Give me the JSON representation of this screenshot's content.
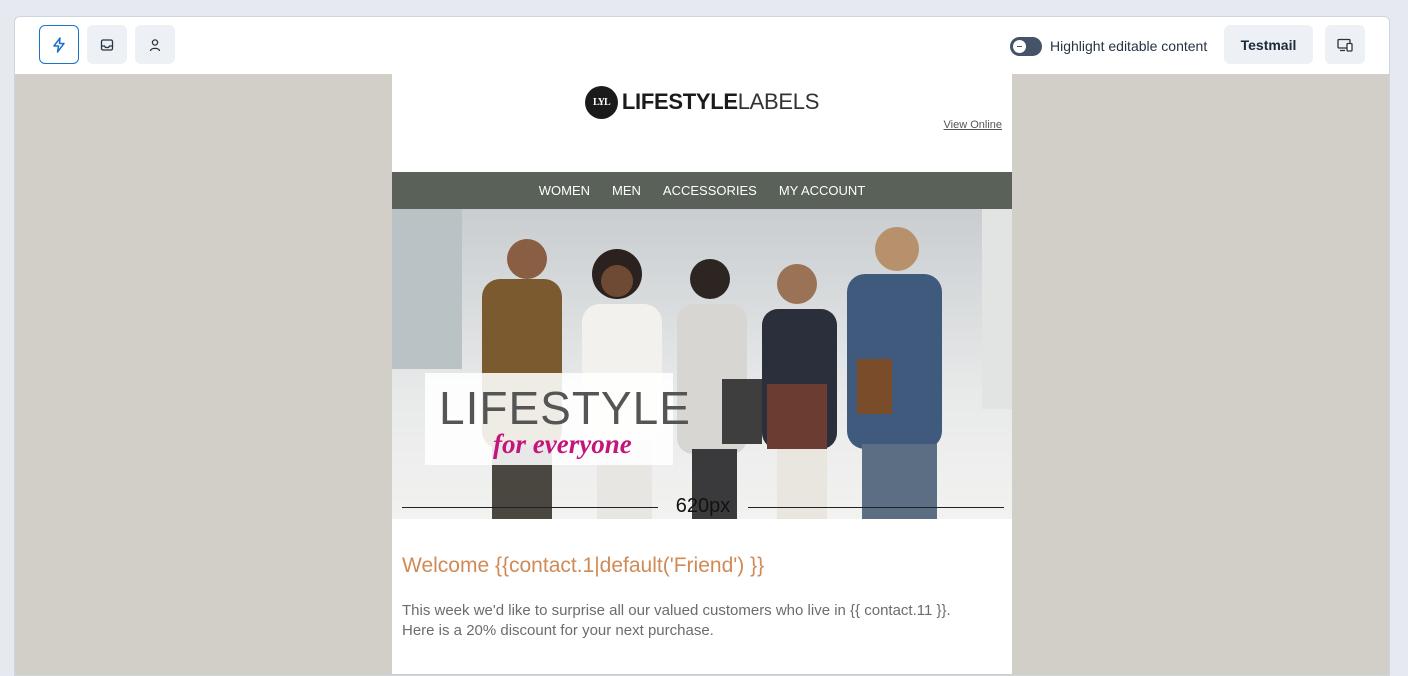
{
  "toolbar": {
    "buttons": [
      {
        "icon": "lightning-icon",
        "active": true
      },
      {
        "icon": "inbox-icon",
        "active": false
      },
      {
        "icon": "user-icon",
        "active": false
      }
    ],
    "highlight_label": "Highlight editable content",
    "highlight_on": true,
    "testmail_label": "Testmail",
    "device_icon": "device-preview-icon"
  },
  "email": {
    "logo_mark": "LYL",
    "logo_bold": "LIFESTYLE",
    "logo_light": "LABELS",
    "view_online": "View Online",
    "nav": [
      "WOMEN",
      "MEN",
      "ACCESSORIES",
      "MY ACCOUNT"
    ],
    "hero": {
      "title": "LIFESTYLE",
      "tagline": "for everyone",
      "width_label": "620px"
    },
    "welcome": "Welcome  {{contact.1|default('Friend') }}",
    "body_line1": "This week we'd like to surprise all our valued customers who live in {{ contact.11 }}.",
    "body_line2": "Here is a 20% discount for your next purchase."
  },
  "colors": {
    "accent_blue": "#1a73c9",
    "nav_bg": "#5a6159",
    "welcome": "#d08a56",
    "tagline": "#c3157a",
    "canvas": "#d2cec8"
  }
}
